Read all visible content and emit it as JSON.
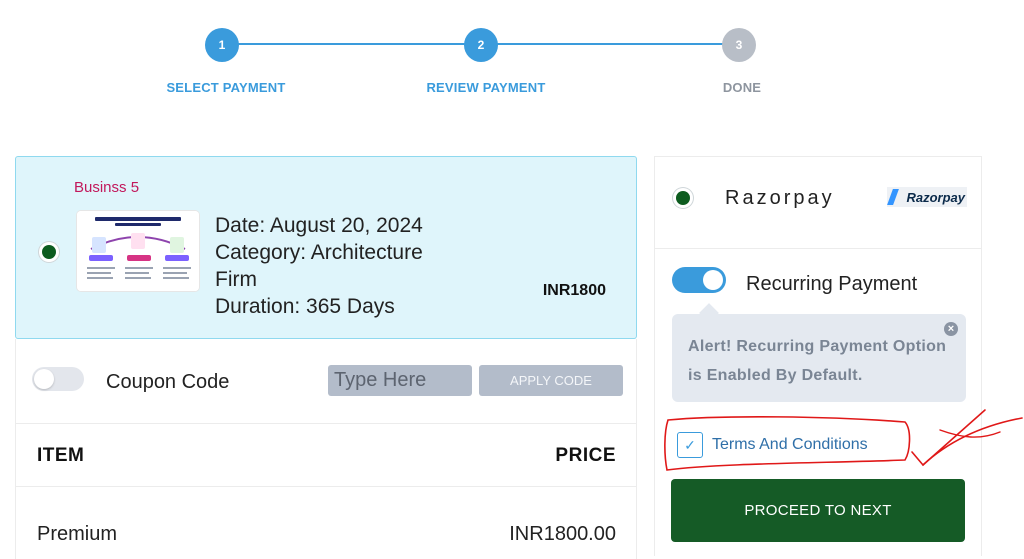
{
  "stepper": {
    "steps": [
      {
        "number": "1",
        "label": "SELECT PAYMENT",
        "state": "complete"
      },
      {
        "number": "2",
        "label": "REVIEW PAYMENT",
        "state": "active"
      },
      {
        "number": "3",
        "label": "DONE",
        "state": "pending"
      }
    ],
    "colors": {
      "active": "#3a9bdc",
      "pending": "#b8bec7"
    }
  },
  "plan": {
    "name": "Businss 5",
    "date": "Date: August 20, 2024",
    "category": "Category: Architecture Firm",
    "duration": "Duration: 365 Days",
    "price": "INR1800",
    "selected": true
  },
  "coupon": {
    "label": "Coupon Code",
    "enabled": false,
    "input_placeholder": "Type Here",
    "apply_label": "APPLY CODE"
  },
  "table": {
    "headers": [
      "ITEM",
      "PRICE"
    ],
    "rows": [
      [
        "Premium",
        "INR1800.00"
      ]
    ]
  },
  "payment": {
    "method_label": "Razorpay",
    "logo_text": "Razorpay",
    "selected": true
  },
  "recurring": {
    "label": "Recurring Payment",
    "enabled": true,
    "alert_text": "Alert! Recurring Payment Option is Enabled By Default.",
    "close_glyph": "×"
  },
  "terms": {
    "label": "Terms And Conditions",
    "checked": true,
    "check_glyph": "✓"
  },
  "proceed_label": "PROCEED TO NEXT",
  "colors": {
    "brand_green": "#155b26",
    "accent_blue": "#3a9bdc",
    "plan_highlight": "#dff5fb",
    "annotation_red": "#e01818"
  }
}
